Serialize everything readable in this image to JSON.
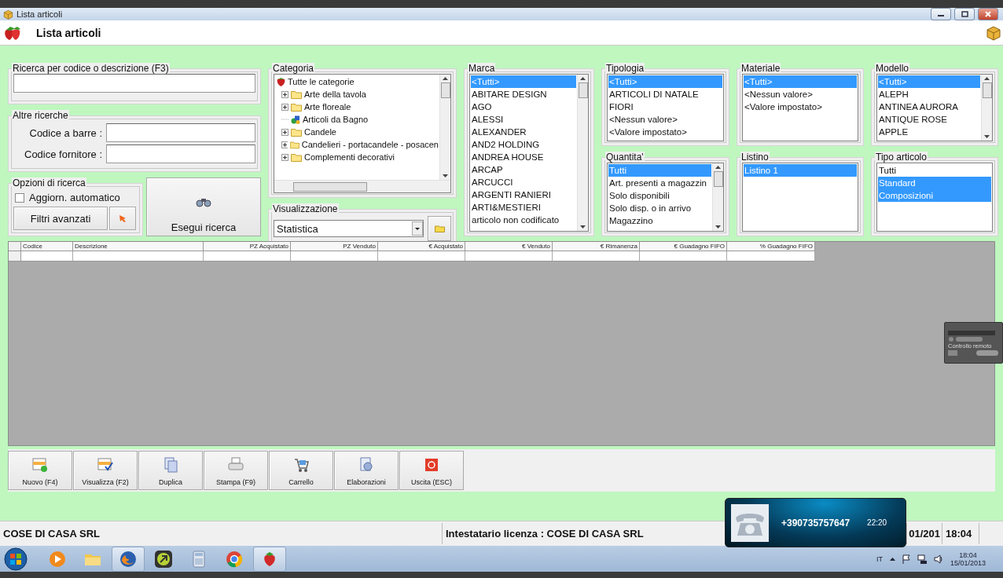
{
  "window": {
    "title": "Lista articoli"
  },
  "header": {
    "title": "Lista articoli"
  },
  "search": {
    "legend": "Ricerca per codice o descrizione (F3)"
  },
  "other_searches": {
    "legend": "Altre ricerche",
    "fields": [
      {
        "label": "Codice a barre :"
      },
      {
        "label": "Codice fornitore :"
      }
    ]
  },
  "options": {
    "legend": "Opzioni di ricerca",
    "auto_update": {
      "label": "Aggiorn. automatico",
      "checked": false
    },
    "advanced_button": "Filtri avanzati"
  },
  "run_button": "Esegui ricerca",
  "category": {
    "legend": "Categoria",
    "tree": [
      {
        "label": "Tutte le categorie",
        "kind": "root",
        "children": [
          {
            "label": "Arte della tavola",
            "kind": "folder"
          },
          {
            "label": "Arte floreale",
            "kind": "folder"
          },
          {
            "label": "Articoli da Bagno",
            "kind": "item"
          },
          {
            "label": "Candele",
            "kind": "folder"
          },
          {
            "label": "Candelieri - portacandele - posacen",
            "kind": "folder"
          },
          {
            "label": "Complementi decorativi",
            "kind": "folder"
          }
        ]
      }
    ]
  },
  "view": {
    "legend": "Visualizzazione",
    "value": "Statistica"
  },
  "lists": [
    {
      "legend": "Marca",
      "scrollbar": true,
      "items": [
        {
          "label": "<Tutti>",
          "selected": true
        },
        {
          "label": "ABITARE DESIGN",
          "selected": false
        },
        {
          "label": "AGO",
          "selected": false
        },
        {
          "label": "ALESSI",
          "selected": false
        },
        {
          "label": "ALEXANDER",
          "selected": false
        },
        {
          "label": "AND2 HOLDING",
          "selected": false
        },
        {
          "label": "ANDREA HOUSE",
          "selected": false
        },
        {
          "label": "ARCAP",
          "selected": false
        },
        {
          "label": "ARCUCCI",
          "selected": false
        },
        {
          "label": "ARGENTI RANIERI",
          "selected": false
        },
        {
          "label": "ARTI&MESTIERI",
          "selected": false
        },
        {
          "label": "articolo non codificato",
          "selected": false
        }
      ]
    },
    {
      "legend": "Tipologia",
      "scrollbar": false,
      "items": [
        {
          "label": "<Tutti>",
          "selected": true
        },
        {
          "label": "ARTICOLI DI NATALE",
          "selected": false
        },
        {
          "label": "FIORI",
          "selected": false
        },
        {
          "label": "<Nessun valore>",
          "selected": false
        },
        {
          "label": "<Valore impostato>",
          "selected": false
        }
      ]
    },
    {
      "legend": "Materiale",
      "scrollbar": false,
      "items": [
        {
          "label": "<Tutti>",
          "selected": true
        },
        {
          "label": "<Nessun valore>",
          "selected": false
        },
        {
          "label": "<Valore impostato>",
          "selected": false
        }
      ]
    },
    {
      "legend": "Modello",
      "scrollbar": true,
      "items": [
        {
          "label": "<Tutti>",
          "selected": true
        },
        {
          "label": "ALEPH",
          "selected": false
        },
        {
          "label": "ANTINEA AURORA",
          "selected": false
        },
        {
          "label": "ANTIQUE ROSE",
          "selected": false
        },
        {
          "label": "APPLE",
          "selected": false
        }
      ]
    },
    {
      "legend": "Quantita'",
      "scrollbar": true,
      "items": [
        {
          "label": "Tutti",
          "selected": true
        },
        {
          "label": "Art. presenti a magazzin",
          "selected": false
        },
        {
          "label": "Solo disponibili",
          "selected": false
        },
        {
          "label": "Solo disp. o in arrivo",
          "selected": false
        },
        {
          "label": "Magazzino",
          "selected": false
        }
      ]
    },
    {
      "legend": "Listino",
      "scrollbar": false,
      "items": [
        {
          "label": "Listino 1",
          "selected": true
        }
      ]
    },
    {
      "legend": "Tipo articolo",
      "scrollbar": false,
      "items": [
        {
          "label": "Tutti",
          "selected": false
        },
        {
          "label": "Standard",
          "selected": true
        },
        {
          "label": "Composizioni",
          "selected": true
        }
      ]
    }
  ],
  "table": {
    "columns": [
      "Codice",
      "Descrizione",
      "PZ Acquistato",
      "PZ Venduto",
      "€ Acquistato",
      "€ Venduto",
      "€ Rimanenza",
      "€ Guadagno FIFO",
      "% Guadagno FIFO"
    ]
  },
  "toolbar": [
    {
      "label": "Nuovo (F4)",
      "kind": "new"
    },
    {
      "label": "Visualizza (F2)",
      "kind": "view"
    },
    {
      "label": "Duplica",
      "kind": "copy"
    },
    {
      "label": "Stampa (F9)",
      "kind": "print"
    },
    {
      "label": "Carrello",
      "kind": "cart"
    },
    {
      "label": "Elaborazioni",
      "kind": "process"
    },
    {
      "label": "Uscita (ESC)",
      "kind": "exit"
    }
  ],
  "remote_widget": {
    "label": "Controllo remoto"
  },
  "status_bar": {
    "company": "COSE DI CASA SRL",
    "license": "Intestatario licenza : COSE DI CASA SRL",
    "date": "01/201",
    "time": "18:04"
  },
  "call_popup": {
    "number": "+390735757647",
    "time": "22:20"
  },
  "taskbar": {
    "apps": [
      {
        "kind": "media",
        "selected": false
      },
      {
        "kind": "folder",
        "selected": false
      },
      {
        "kind": "firefox",
        "selected": true
      },
      {
        "kind": "arrow",
        "selected": false
      },
      {
        "kind": "calculator",
        "selected": false
      },
      {
        "kind": "chrome",
        "selected": false
      },
      {
        "kind": "strawberry",
        "selected": true
      }
    ],
    "language": "IT",
    "time": "18:04",
    "date": "15/01/2013"
  }
}
